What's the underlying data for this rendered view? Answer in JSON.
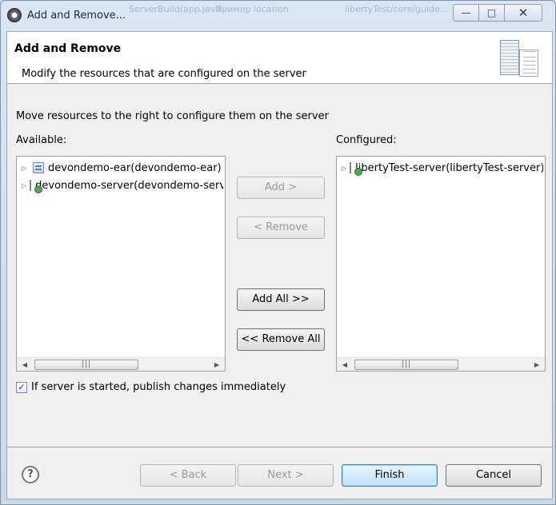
{
  "window": {
    "title": "Add and Remove...",
    "background_tabs": [
      "ServerBuild(app.java",
      "Пример location",
      "libertyTest/core/guide..."
    ],
    "controls": {
      "minimize": "—",
      "maximize": "□",
      "close": "✕"
    }
  },
  "header": {
    "title": "Add and Remove",
    "description": "Modify the resources that are configured on the server"
  },
  "instructions": "Move resources to the right to configure them on the server",
  "available": {
    "label": "Available:",
    "items": [
      {
        "label": "devondemo-ear(devondemo-ear)",
        "icon": "ear-project-icon"
      },
      {
        "label": "devondemo-server(devondemo-server)",
        "icon": "server-project-icon"
      }
    ]
  },
  "configured": {
    "label": "Configured:",
    "items": [
      {
        "label": "libertyTest-server(libertyTest-server)",
        "icon": "server-project-icon"
      }
    ]
  },
  "buttons": {
    "add": "Add >",
    "remove": "< Remove",
    "add_all": "Add All >>",
    "remove_all": "<< Remove All",
    "back": "< Back",
    "next": "Next >",
    "finish": "Finish",
    "cancel": "Cancel"
  },
  "publish_option": {
    "label": "If server is started, publish changes immediately",
    "checked": true
  },
  "glyphs": {
    "expander": "▷",
    "checkmark": "✓",
    "help": "?",
    "scroll_left": "◀",
    "scroll_right": "▶",
    "grip": "|||"
  }
}
